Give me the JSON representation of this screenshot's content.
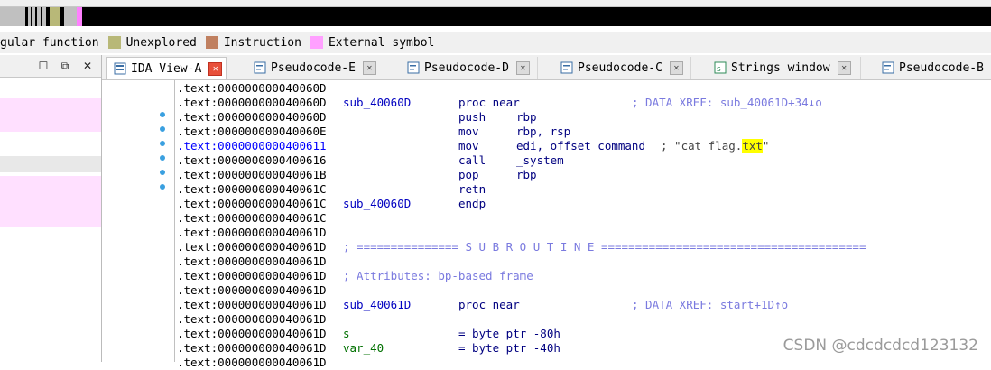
{
  "legend": {
    "items": [
      {
        "label": "gular function",
        "color": "",
        "swatch": false
      },
      {
        "label": "Unexplored",
        "color": "#b8b878",
        "swatch": true
      },
      {
        "label": "Instruction",
        "color": "#c08060",
        "swatch": true
      },
      {
        "label": "External symbol",
        "color": "#ffa0ff",
        "swatch": true
      }
    ]
  },
  "tabs": [
    {
      "label": "IDA View-A",
      "icon": "ida-view-icon",
      "active": true
    },
    {
      "label": "Pseudocode-E",
      "icon": "pseudocode-icon",
      "active": false
    },
    {
      "label": "Pseudocode-D",
      "icon": "pseudocode-icon",
      "active": false
    },
    {
      "label": "Pseudocode-C",
      "icon": "pseudocode-icon",
      "active": false
    },
    {
      "label": "Strings window",
      "icon": "strings-icon",
      "active": false
    },
    {
      "label": "Pseudocode-B",
      "icon": "pseudocode-icon",
      "active": false
    }
  ],
  "left_window_buttons": {
    "restore": "☐",
    "float": "⧉",
    "close": "✕"
  },
  "code_lines": [
    {
      "addr": ".text:000000000040060D",
      "label": "",
      "mnem": "",
      "ops": "",
      "comment": ""
    },
    {
      "addr": ".text:000000000040060D",
      "label": "sub_40060D",
      "mnem": "proc near",
      "ops": "",
      "comment": "; DATA XREF: sub_40061D+34↓o"
    },
    {
      "addr": ".text:000000000040060D",
      "label": "",
      "mnem": "push",
      "ops": "rbp",
      "comment": ""
    },
    {
      "addr": ".text:000000000040060E",
      "label": "",
      "mnem": "mov",
      "ops": "rbp, rsp",
      "comment": ""
    },
    {
      "addr": ".text:0000000000400611",
      "label": "",
      "mnem": "mov",
      "ops": "edi, offset command",
      "comment": "; \"cat flag.txt\"",
      "current": true
    },
    {
      "addr": ".text:0000000000400616",
      "label": "",
      "mnem": "call",
      "ops": "_system",
      "comment": ""
    },
    {
      "addr": ".text:000000000040061B",
      "label": "",
      "mnem": "pop",
      "ops": "rbp",
      "comment": ""
    },
    {
      "addr": ".text:000000000040061C",
      "label": "",
      "mnem": "retn",
      "ops": "",
      "comment": ""
    },
    {
      "addr": ".text:000000000040061C",
      "label": "sub_40060D",
      "mnem": "endp",
      "ops": "",
      "comment": ""
    },
    {
      "addr": ".text:000000000040061C",
      "label": "",
      "mnem": "",
      "ops": "",
      "comment": ""
    },
    {
      "addr": ".text:000000000040061D",
      "label": "",
      "mnem": "",
      "ops": "",
      "comment": ""
    },
    {
      "addr": ".text:000000000040061D",
      "label": "",
      "mnem": "",
      "ops": "",
      "comment": "; =============== S U B R O U T I N E ======================================="
    },
    {
      "addr": ".text:000000000040061D",
      "label": "",
      "mnem": "",
      "ops": "",
      "comment": ""
    },
    {
      "addr": ".text:000000000040061D",
      "label": "",
      "mnem": "",
      "ops": "",
      "comment": "; Attributes: bp-based frame"
    },
    {
      "addr": ".text:000000000040061D",
      "label": "",
      "mnem": "",
      "ops": "",
      "comment": ""
    },
    {
      "addr": ".text:000000000040061D",
      "label": "sub_40061D",
      "mnem": "proc near",
      "ops": "",
      "comment": "; DATA XREF: start+1D↑o"
    },
    {
      "addr": ".text:000000000040061D",
      "label": "",
      "mnem": "",
      "ops": "",
      "comment": ""
    },
    {
      "addr": ".text:000000000040061D",
      "label": "s",
      "mnem": "= byte ptr -80h",
      "ops": "",
      "comment": "",
      "var": true
    },
    {
      "addr": ".text:000000000040061D",
      "label": "var_40",
      "mnem": "= byte ptr -40h",
      "ops": "",
      "comment": "",
      "var": true
    },
    {
      "addr": ".text:000000000040061D",
      "label": "",
      "mnem": "",
      "ops": "",
      "comment": ""
    }
  ],
  "watermark": "CSDN @cdcdcdcd123132",
  "colors": {
    "accent_label": "#0000c0",
    "comment": "#7a7adf",
    "highlight": "#ffff00",
    "breakpoint_dot": "#3aa0e0",
    "external_symbol_row": "#ffe0ff"
  }
}
